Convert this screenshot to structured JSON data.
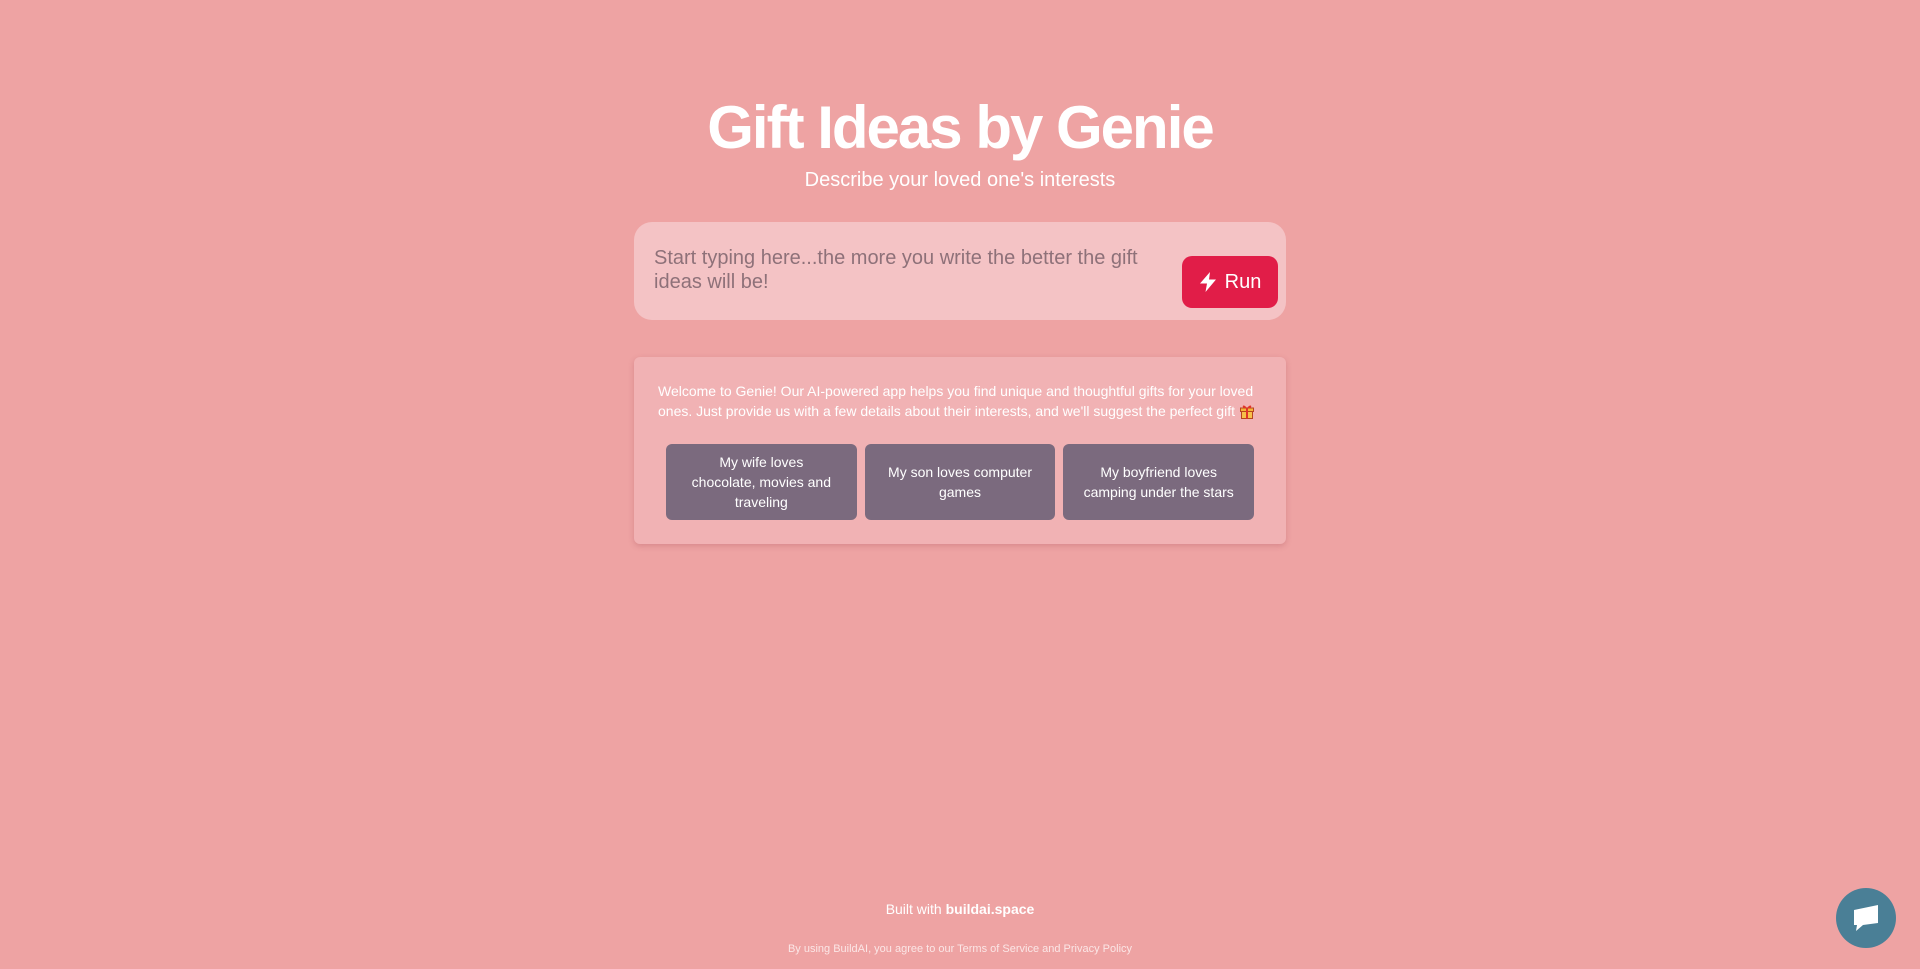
{
  "header": {
    "title": "Gift Ideas by Genie",
    "subtitle": "Describe your loved one's interests"
  },
  "prompt": {
    "placeholder": "Start typing here...the more you write the better the gift ideas will be!",
    "value": "",
    "run_label": "Run",
    "run_icon": "lightning-bolt-icon"
  },
  "welcome": {
    "text": "Welcome to Genie! Our AI-powered app helps you find unique and thoughtful gifts for your loved ones. Just provide us with a few details about their interests, and we'll suggest the perfect gift",
    "icon": "gift-icon",
    "examples": [
      {
        "label": "My wife loves chocolate, movies and traveling"
      },
      {
        "label": "My son loves computer games"
      },
      {
        "label": "My boyfriend loves camping under the stars"
      }
    ]
  },
  "footer": {
    "built_with_prefix": "Built with ",
    "built_with_link": "buildai.space",
    "legal_prefix": "By using BuildAI, you agree to our ",
    "terms_link": "Terms of Service",
    "legal_and": " and ",
    "privacy_link": "Privacy Policy"
  },
  "chat": {
    "icon": "chat-icon"
  },
  "colors": {
    "background": "#eea3a3",
    "accent": "#e11d48",
    "example_button": "#7b6a7e",
    "chat": "#4a7f96"
  }
}
